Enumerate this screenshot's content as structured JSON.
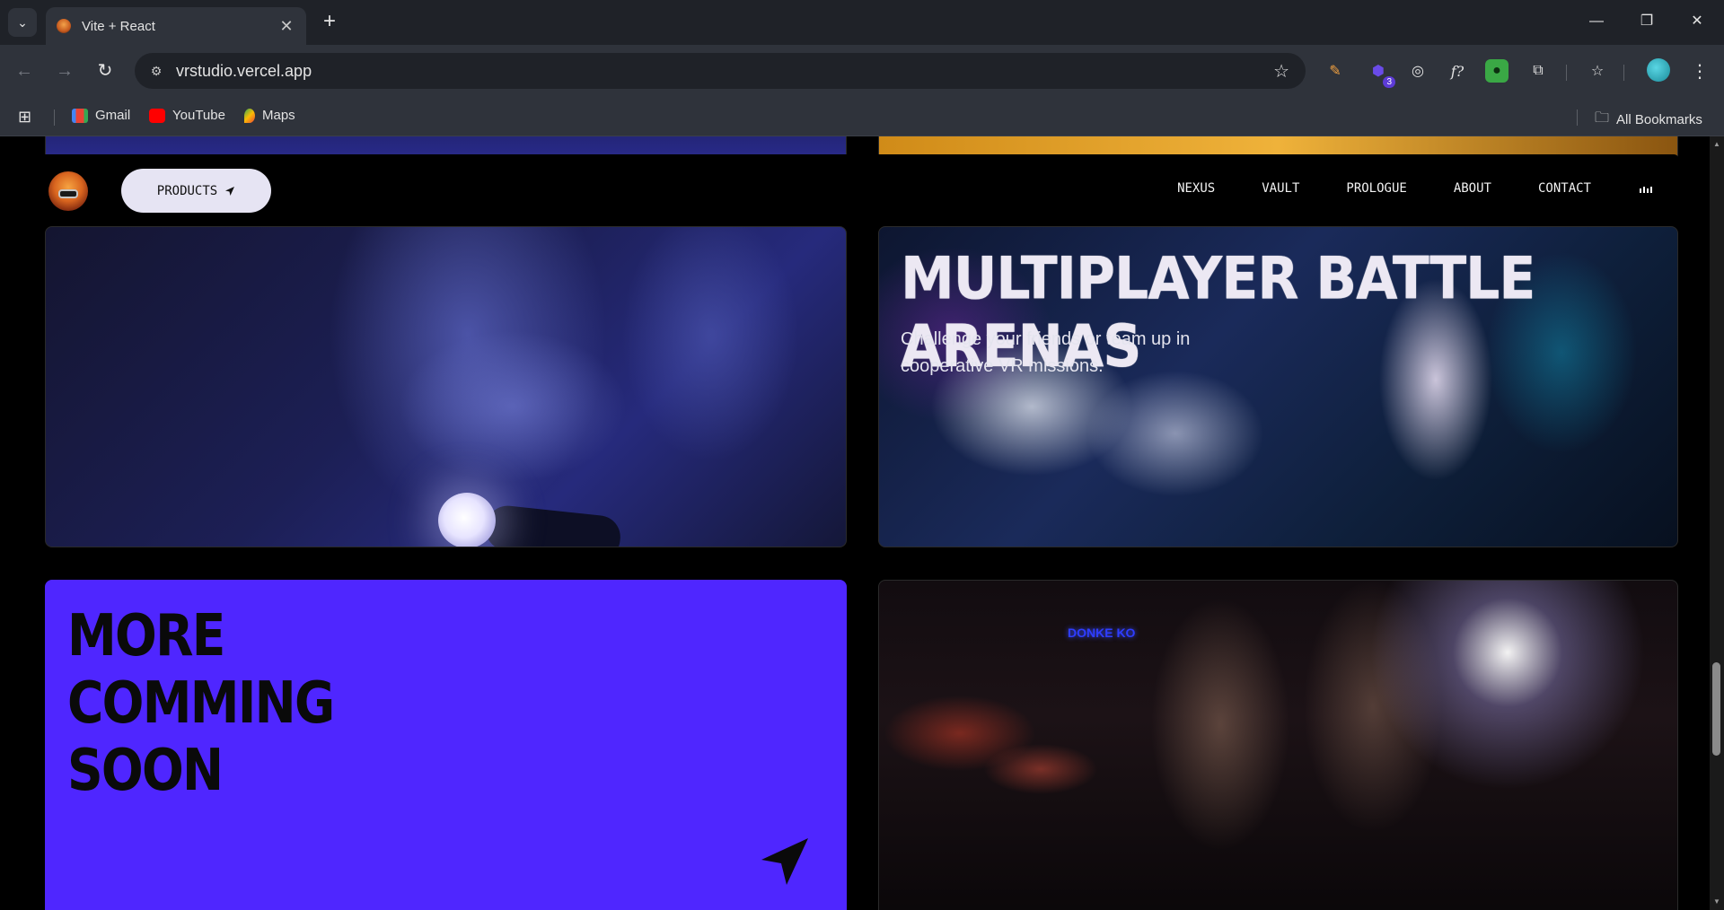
{
  "browser": {
    "tab_title": "Vite + React",
    "url": "vrstudio.vercel.app",
    "extension_badge": "3",
    "extension_fx": "f?",
    "bookmarks": [
      {
        "label": "Gmail",
        "icon": "gmail-icon"
      },
      {
        "label": "YouTube",
        "icon": "youtube-icon"
      },
      {
        "label": "Maps",
        "icon": "maps-icon"
      }
    ],
    "all_bookmarks": "All Bookmarks"
  },
  "navbar": {
    "products_label": "PRODUCTS",
    "links": [
      "NEXUS",
      "VAULT",
      "PROLOGUE",
      "ABOUT",
      "CONTACT"
    ]
  },
  "cards": {
    "arena": {
      "title": "MULTIPLAYER BATTLE ARENAS",
      "description": "Challenge your friends or team up in cooperative VR missions."
    },
    "more": {
      "title_lines": [
        "MORE",
        "COMMING",
        "SOON"
      ]
    },
    "party": {
      "neon_sign": "DONKE KO"
    }
  },
  "colors": {
    "more_card": "#4f26ff",
    "products_btn": "#e6e4f3",
    "page_bg": "#000000"
  }
}
